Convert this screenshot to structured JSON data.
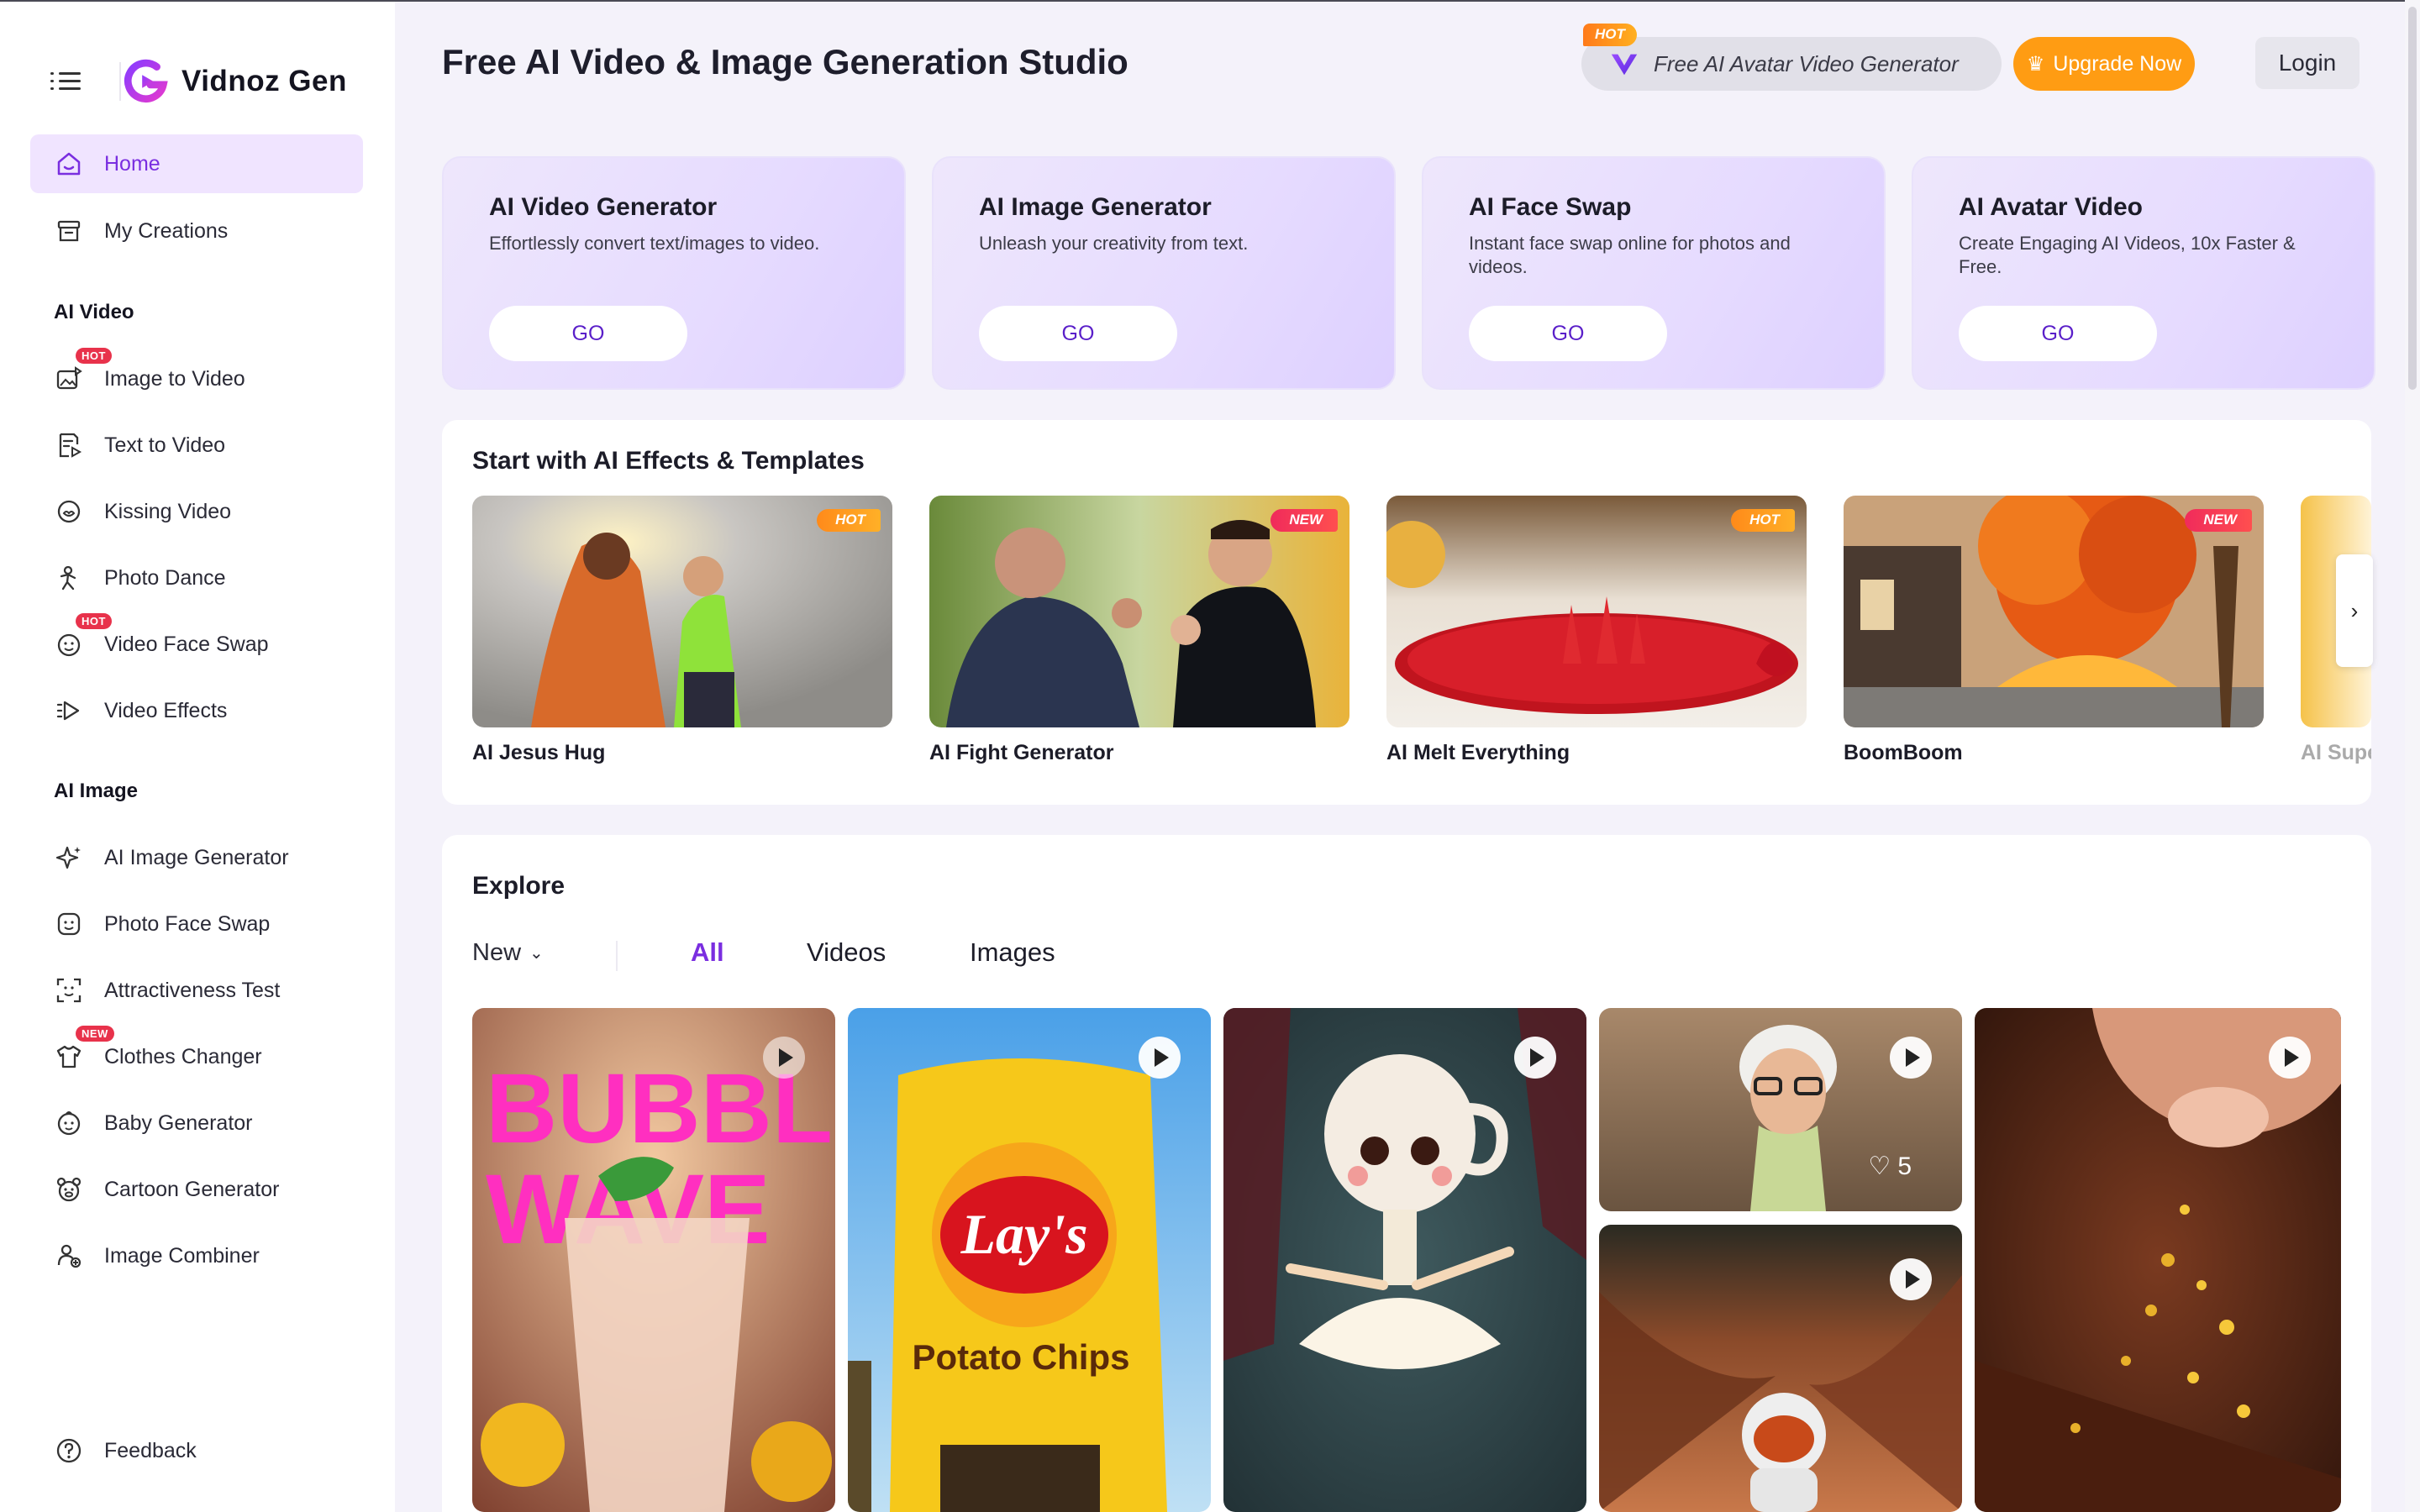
{
  "app": {
    "name": "Vidnoz Gen"
  },
  "header": {
    "title": "Free AI Video & Image Generation Studio",
    "avatar_pill_tag": "HOT",
    "avatar_pill_label": "Free AI Avatar Video Generator",
    "upgrade_label": "Upgrade Now",
    "login_label": "Login"
  },
  "sidebar": {
    "top_items": [
      {
        "label": "Home",
        "icon": "home-icon",
        "active": true
      },
      {
        "label": "My Creations",
        "icon": "archive-icon"
      }
    ],
    "sections": [
      {
        "title": "AI Video",
        "items": [
          {
            "label": "Image to Video",
            "icon": "image-video-icon",
            "badge": "HOT"
          },
          {
            "label": "Text to Video",
            "icon": "text-video-icon"
          },
          {
            "label": "Kissing Video",
            "icon": "kiss-icon"
          },
          {
            "label": "Photo Dance",
            "icon": "dance-icon"
          },
          {
            "label": "Video Face Swap",
            "icon": "face-swap-icon",
            "badge": "HOT"
          },
          {
            "label": "Video Effects",
            "icon": "effects-icon"
          }
        ]
      },
      {
        "title": "AI Image",
        "items": [
          {
            "label": "AI Image Generator",
            "icon": "sparkle-icon"
          },
          {
            "label": "Photo Face Swap",
            "icon": "face-icon"
          },
          {
            "label": "Attractiveness Test",
            "icon": "face-scan-icon"
          },
          {
            "label": "Clothes Changer",
            "icon": "shirt-icon",
            "badge": "NEW"
          },
          {
            "label": "Baby Generator",
            "icon": "baby-icon"
          },
          {
            "label": "Cartoon Generator",
            "icon": "cartoon-icon"
          },
          {
            "label": "Image Combiner",
            "icon": "combine-icon"
          }
        ]
      }
    ],
    "feedback_label": "Feedback"
  },
  "tools": [
    {
      "title": "AI Video Generator",
      "desc": "Effortlessly convert text/images to video.",
      "button": "GO"
    },
    {
      "title": "AI Image Generator",
      "desc": "Unleash your creativity from text.",
      "button": "GO"
    },
    {
      "title": "AI Face Swap",
      "desc": "Instant face swap online for photos and videos.",
      "button": "GO"
    },
    {
      "title": "AI Avatar Video",
      "desc": "Create Engaging AI Videos, 10x Faster & Free.",
      "button": "GO"
    }
  ],
  "templates": {
    "title": "Start with AI Effects & Templates",
    "items": [
      {
        "name": "AI Jesus Hug",
        "tag": "HOT"
      },
      {
        "name": "AI Fight Generator",
        "tag": "NEW"
      },
      {
        "name": "AI Melt Everything",
        "tag": "HOT"
      },
      {
        "name": "BoomBoom",
        "tag": "NEW"
      },
      {
        "name": "AI Super S",
        "tag": ""
      }
    ]
  },
  "explore": {
    "title": "Explore",
    "sort_value": "New",
    "tabs": [
      "All",
      "Videos",
      "Images"
    ],
    "active_tab": "All",
    "tiles": [
      {
        "subject": "bubble wave drink",
        "likes": ""
      },
      {
        "subject": "potato chips bag",
        "likes": ""
      },
      {
        "subject": "ballerina teacup",
        "likes": ""
      },
      {
        "subject": "old man cartoon",
        "likes": "5"
      },
      {
        "subject": "astronaut",
        "likes": ""
      },
      {
        "subject": "gold flakes",
        "likes": ""
      }
    ],
    "tile_texts": {
      "neon_text_1": "BUBBLE",
      "neon_text_2": "WAVE",
      "chips_brand": "Lay's",
      "chips_product": "Potato Chips"
    }
  },
  "colors": {
    "accent": "#7a2ee0",
    "upgrade": "#ff9c13",
    "hot_badge": "#e8324b"
  }
}
